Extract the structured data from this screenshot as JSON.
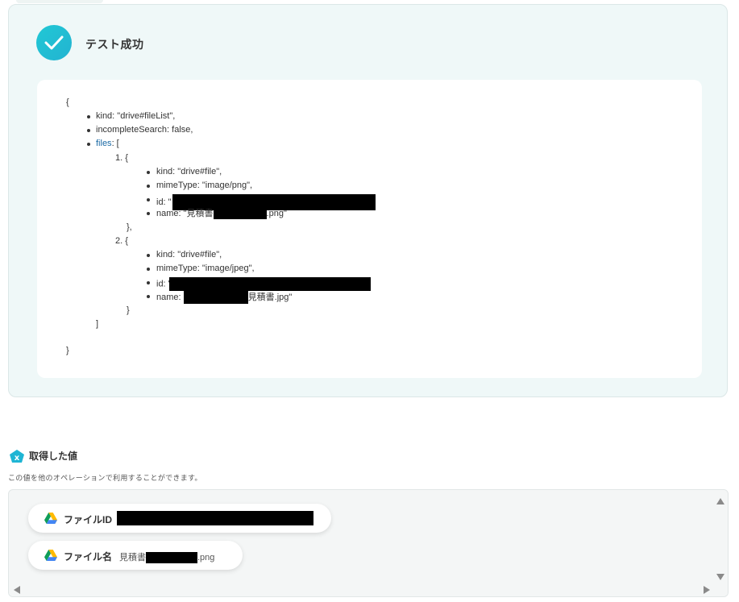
{
  "result": {
    "title": "テスト成功",
    "status_color": "#22c3d4",
    "json_lines": {
      "open_brace": "{",
      "kind": "kind: \"drive#fileList\",",
      "incomplete": "incompleteSearch: false,",
      "files_key": "files",
      "files_rest": ": [",
      "item1_num": "1. {",
      "item1_kind": "kind: \"drive#file\",",
      "item1_mime": "mimeType: \"image/png\",",
      "item1_id": "id: \"",
      "item1_name_pre": "name: \"見積書",
      "item1_name_post": ".png\"",
      "item1_close": "},",
      "item2_num": "2. {",
      "item2_kind": "kind: \"drive#file\",",
      "item2_mime": "mimeType: \"image/jpeg\",",
      "item2_id": "id: \"",
      "item2_name_pre": "name: ",
      "item2_name_post": "見積書.jpg\"",
      "item2_close": "}",
      "array_close": "]",
      "close_brace": "}"
    }
  },
  "acquired": {
    "title": "取得した値",
    "description": "この値を他のオペレーションで利用することができます。",
    "items": [
      {
        "label": "ファイルID",
        "value": "",
        "icon": "google-drive-icon"
      },
      {
        "label": "ファイル名",
        "value_pre": "見積書",
        "value_post": ".png",
        "icon": "google-drive-icon"
      }
    ]
  }
}
